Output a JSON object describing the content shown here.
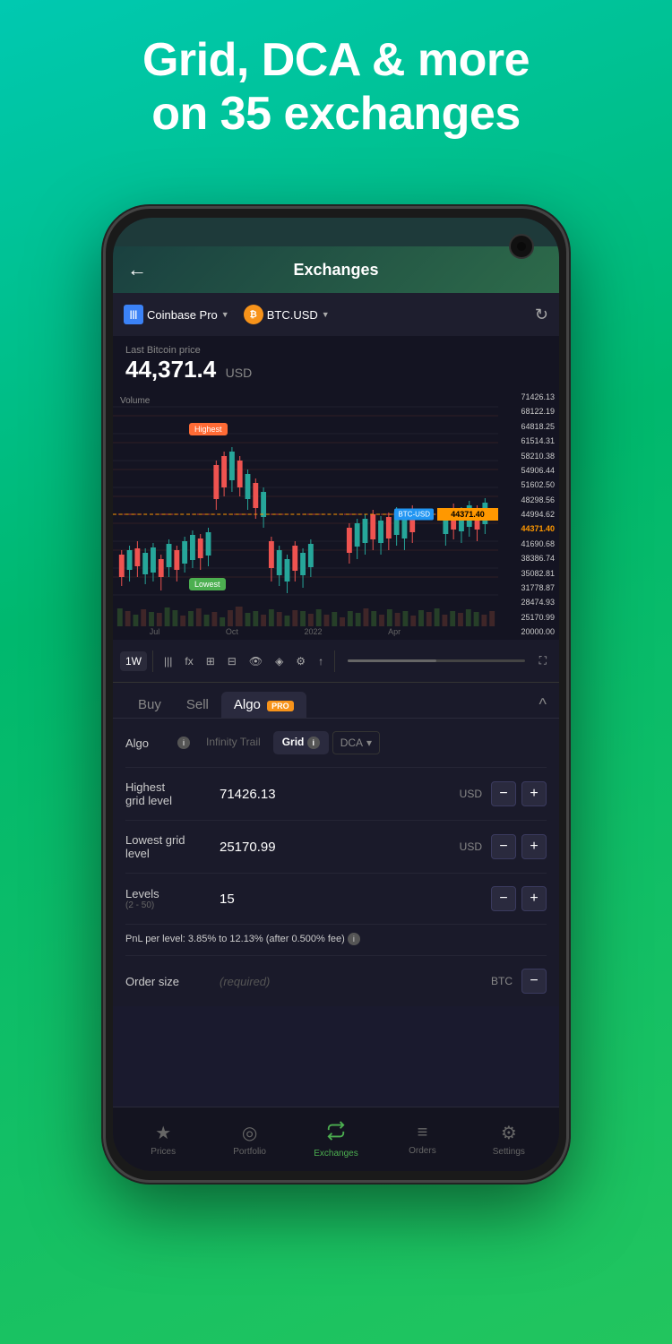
{
  "header": {
    "line1": "Grid, DCA & more",
    "line2": "on 35 exchanges"
  },
  "nav": {
    "back_icon": "←",
    "title": "Exchanges",
    "camera": true
  },
  "exchange_bar": {
    "exchange_name": "Coinbase Pro",
    "pair_name": "BTC.USD",
    "dropdown": "▼",
    "refresh_icon": "↻"
  },
  "price": {
    "label": "Last Bitcoin price",
    "value": "44,371.4",
    "currency": "USD"
  },
  "chart": {
    "price_ticks": [
      "71426.13",
      "68122.19",
      "64818.25",
      "61514.31",
      "58210.38",
      "54906.44",
      "51602.50",
      "48298.56",
      "44994.62",
      "44371.40",
      "41690.68",
      "38386.74",
      "35082.81",
      "31778.87",
      "28474.93",
      "25170.99",
      "20000.00"
    ],
    "time_labels": [
      "Jul",
      "Oct",
      "2022",
      "Apr"
    ],
    "current_price": "44371.40",
    "highest_label": "Highest",
    "lowest_label": "Lowest",
    "btc_usd_tag": "BTC-USD",
    "volume_label": "Volume"
  },
  "toolbar": {
    "timeframe": "1W",
    "tools": [
      "|||",
      "fx",
      "⊞",
      "⊟",
      "👁",
      "◈",
      "⚙",
      "↑",
      "⛶"
    ]
  },
  "tabs": {
    "buy_label": "Buy",
    "sell_label": "Sell",
    "algo_label": "Algo",
    "pro_badge": "PRO",
    "collapse_icon": "^"
  },
  "algo_row": {
    "label": "Algo",
    "info_icon": "i",
    "options": [
      {
        "name": "Infinity Trail",
        "active": false
      },
      {
        "name": "Grid",
        "active": true
      },
      {
        "name": "DCA",
        "active": false
      }
    ],
    "grid_info_icon": "i",
    "dca_dropdown_arrow": "▾"
  },
  "highest_grid": {
    "label": "Highest\ngrid level",
    "value": "71426.13",
    "currency": "USD",
    "minus": "−",
    "plus": "+"
  },
  "lowest_grid": {
    "label": "Lowest grid\nlevel",
    "value": "25170.99",
    "currency": "USD",
    "minus": "−",
    "plus": "+"
  },
  "levels": {
    "label": "Levels",
    "sublabel": "(2 - 50)",
    "value": "15",
    "minus": "−",
    "plus": "+"
  },
  "pnl": {
    "label": "PnL per level:",
    "value": "3.85% to 12.13% (after 0.500% fee)",
    "info_icon": "i"
  },
  "order_size": {
    "label": "Order size",
    "placeholder": "(required)",
    "currency": "BTC",
    "minus": "−"
  },
  "bottom_nav": {
    "items": [
      {
        "icon": "★",
        "label": "Prices",
        "active": false
      },
      {
        "icon": "◎",
        "label": "Portfolio",
        "active": false
      },
      {
        "icon": "↗",
        "label": "Exchanges",
        "active": true
      },
      {
        "icon": "≡",
        "label": "Orders",
        "active": false
      },
      {
        "icon": "⚙",
        "label": "Settings",
        "active": false
      }
    ]
  }
}
